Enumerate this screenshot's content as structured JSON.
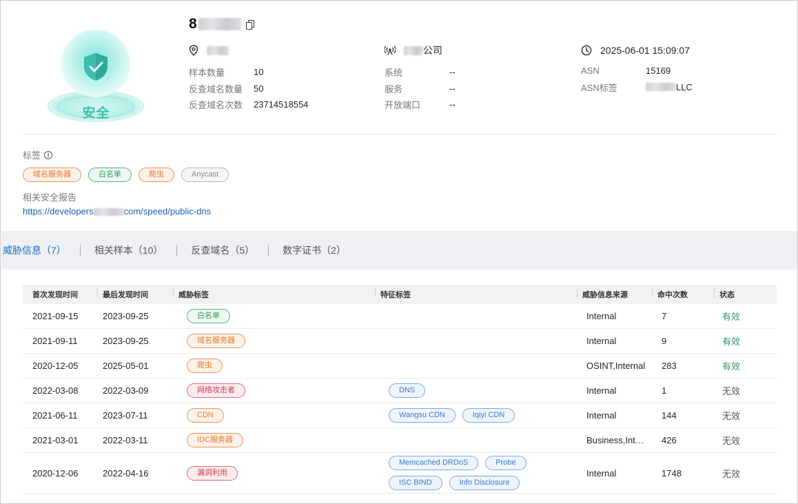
{
  "badge": {
    "label": "安全"
  },
  "header": {
    "title": "8"
  },
  "location": {
    "value": ""
  },
  "org": {
    "suffix": "公司"
  },
  "time": {
    "value": "2025-06-01 15:09:07"
  },
  "stats_left": [
    {
      "label": "样本数量",
      "value": "10"
    },
    {
      "label": "反查域名数量",
      "value": "50"
    },
    {
      "label": "反查域名次数",
      "value": "23714518554"
    }
  ],
  "stats_mid": [
    {
      "label": "系统",
      "value": "--"
    },
    {
      "label": "服务",
      "value": "--"
    },
    {
      "label": "开放端口",
      "value": "--"
    }
  ],
  "stats_right": [
    {
      "label": "ASN",
      "value": "15169"
    },
    {
      "label": "ASN标签",
      "value": "LLC"
    }
  ],
  "tags_section": {
    "label": "标签",
    "items": [
      {
        "label": "域名服务器",
        "color": "#e07a2e"
      },
      {
        "label": "白名单",
        "color": "#2f9a5b"
      },
      {
        "label": "爬虫",
        "color": "#e07a2e"
      },
      {
        "label": "Anycast",
        "color": "#888888"
      }
    ]
  },
  "report": {
    "label": "相关安全报告",
    "link_prefix": "https://developers",
    "link_suffix": "com/speed/public-dns"
  },
  "tabs": [
    {
      "label": "威胁信息（7）",
      "active": true
    },
    {
      "label": "相关样本（10）"
    },
    {
      "label": "反查域名（5）"
    },
    {
      "label": "数字证书（2）"
    }
  ],
  "table": {
    "headers": [
      "首次发现时间",
      "最后发现时间",
      "威胁标签",
      "特征标签",
      "威胁信息来源",
      "命中次数",
      "状态"
    ],
    "rows": [
      {
        "first": "2021-09-15",
        "last": "2023-09-25",
        "threat": "白名单",
        "threat_color": "green",
        "features": [],
        "source": "Internal",
        "hits": "7",
        "status": "有效",
        "valid": true
      },
      {
        "first": "2021-09-11",
        "last": "2023-09-25",
        "threat": "域名服务器",
        "threat_color": "orange",
        "features": [],
        "source": "Internal",
        "hits": "9",
        "status": "有效",
        "valid": true
      },
      {
        "first": "2020-12-05",
        "last": "2025-05-01",
        "threat": "爬虫",
        "threat_color": "orange",
        "features": [],
        "source": "OSINT,Internal",
        "hits": "283",
        "status": "有效",
        "valid": true
      },
      {
        "first": "2022-03-08",
        "last": "2022-03-09",
        "threat": "网络攻击者",
        "threat_color": "red",
        "features": [
          "DNS"
        ],
        "source": "Internal",
        "hits": "1",
        "status": "无效",
        "valid": false
      },
      {
        "first": "2021-06-11",
        "last": "2023-07-11",
        "threat": "CDN",
        "threat_color": "orange",
        "features": [
          "Wangsu CDN",
          "Iqiyi CDN"
        ],
        "source": "Internal",
        "hits": "144",
        "status": "无效",
        "valid": false
      },
      {
        "first": "2021-03-01",
        "last": "2022-03-11",
        "threat": "IDC服务器",
        "threat_color": "orange",
        "features": [],
        "source": "Business,Inter…",
        "hits": "426",
        "status": "无效",
        "valid": false
      },
      {
        "first": "2020-12-06",
        "last": "2022-04-16",
        "threat": "漏洞利用",
        "threat_color": "red",
        "features": [
          "Memcached DRDoS",
          "Probe",
          "ISC BIND",
          "Info Disclosure"
        ],
        "source": "Internal",
        "hits": "1748",
        "status": "无效",
        "valid": false
      }
    ]
  }
}
